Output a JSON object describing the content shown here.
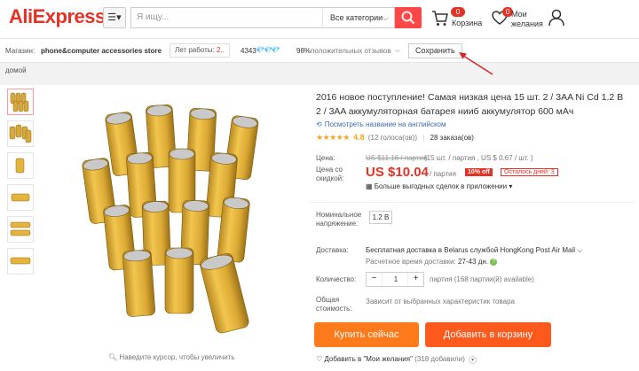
{
  "header": {
    "logo": "AliExpress",
    "menu_icon": "menu-icon",
    "search_placeholder": "Я ищу...",
    "category_select": "Все категории",
    "cart_badge": "0",
    "cart_label": "Корзина",
    "wishlist_badge": "0",
    "wishlist_label": "Мои желания",
    "accent": "#e43225"
  },
  "store": {
    "label": "Магазин:",
    "name": "phone&computer accessories store",
    "years_label": "Лет работы: ",
    "years_value": "2..",
    "score": "4343",
    "diamonds": "💎💎💎",
    "feedback_pct": "98%",
    "feedback_label": "положительных отзывов",
    "save_label": "Сохранить"
  },
  "breadcrumb": "домой",
  "gallery": {
    "zoom_hint": "Наведите курсор, чтобы увеличить"
  },
  "product": {
    "title": "2016 новое поступление! Самая низкая цена 15 шт. 2 / 3AA Ni Cd 1.2 В 2 / 3AA аккумуляторная батарея нииб аккумулятор 600 мАч",
    "translate_link": "Посмотреть название на английском",
    "stars": "★★★★★",
    "rating": "4.8",
    "votes": "(12 голоса(ов))",
    "orders": "28 заказа(ов)"
  },
  "price": {
    "price_label": "Цена:",
    "old_price": "US $11.16 / партия",
    "old_price_note": "(15 шт. / партия , US $ 0.67 / шт. )",
    "discount_label": "Цена со скидкой:",
    "new_price": "US $10.04",
    "new_price_unit": "/ партия",
    "off_badge": "10% off",
    "days_left": "Осталось дней: 3",
    "app_deals": "Больше выгодных сделок в приложении"
  },
  "options": {
    "voltage_label": "Номинальное напряжение:",
    "voltage_value": "1.2 В",
    "shipping_label": "Доставка:",
    "shipping_text": "Бесплатная доставка в Belarus службой HongKong Post Air Mail",
    "delivery_time_label": "Расчетное время доставки:",
    "delivery_time_value": "27-43 дн.",
    "quantity_label": "Количество:",
    "quantity_value": "1",
    "quantity_note": "партия (168 партии(й) available)",
    "total_label": "Общая стоимость:",
    "total_note": "Зависит от выбранных характеристик товара"
  },
  "actions": {
    "buy_now": "Купить сейчас",
    "add_to_cart": "Добавить в корзину",
    "add_to_wishlist": "Добавить в \"Мои желания\"",
    "wishlist_count": "(318 добавили)"
  }
}
